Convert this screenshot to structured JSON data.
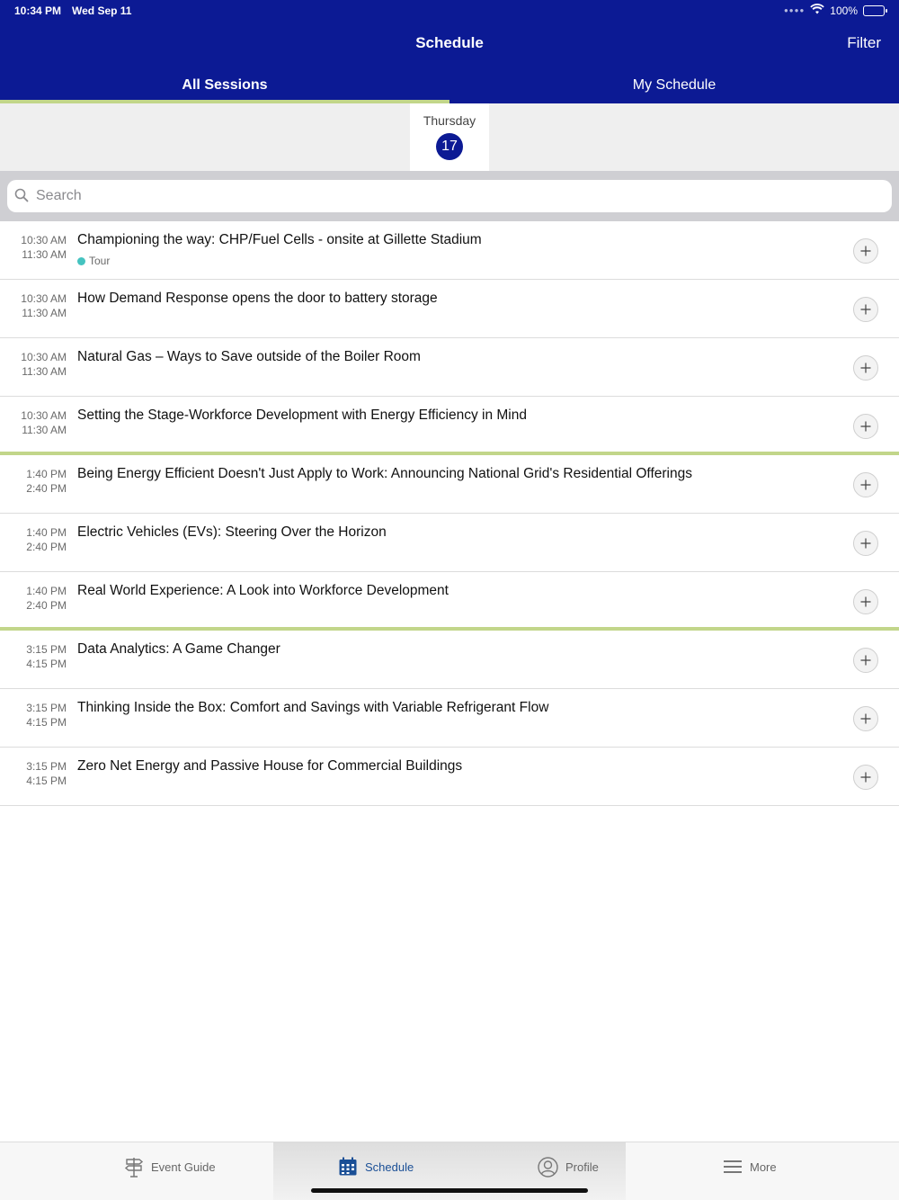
{
  "status_bar": {
    "time": "10:34 PM",
    "date": "Wed Sep 11",
    "battery": "100%"
  },
  "nav": {
    "title": "Schedule",
    "filter_label": "Filter"
  },
  "tabs": [
    {
      "label": "All Sessions",
      "active": true
    },
    {
      "label": "My Schedule",
      "active": false
    }
  ],
  "date_picker": {
    "weekday": "Thursday",
    "day": "17"
  },
  "search": {
    "placeholder": "Search"
  },
  "sessions": [
    {
      "start": "10:30 AM",
      "end": "11:30 AM",
      "title": "Championing the way:  CHP/Fuel Cells - onsite at  Gillette Stadium",
      "track": "Tour"
    },
    {
      "start": "10:30 AM",
      "end": "11:30 AM",
      "title": "How Demand Response opens the door to battery storage"
    },
    {
      "start": "10:30 AM",
      "end": "11:30 AM",
      "title": "Natural Gas – Ways to Save outside of the Boiler Room"
    },
    {
      "start": "10:30 AM",
      "end": "11:30 AM",
      "title": "Setting the Stage-Workforce Development with Energy Efficiency in Mind"
    },
    {
      "start": "1:40 PM",
      "end": "2:40 PM",
      "title": "Being Energy Efficient Doesn't Just Apply to Work:  Announcing National Grid's Residential Offerings"
    },
    {
      "start": "1:40 PM",
      "end": "2:40 PM",
      "title": "Electric Vehicles (EVs): Steering Over the Horizon"
    },
    {
      "start": "1:40 PM",
      "end": "2:40 PM",
      "title": "Real World Experience: A Look into Workforce Development"
    },
    {
      "start": "3:15 PM",
      "end": "4:15 PM",
      "title": "Data Analytics: A Game Changer"
    },
    {
      "start": "3:15 PM",
      "end": "4:15 PM",
      "title": "Thinking Inside the Box:  Comfort and Savings with Variable Refrigerant Flow"
    },
    {
      "start": "3:15 PM",
      "end": "4:15 PM",
      "title": "Zero Net Energy and Passive House for Commercial Buildings"
    }
  ],
  "tabbar": [
    {
      "label": "Event Guide",
      "icon": "signpost-icon",
      "active": false
    },
    {
      "label": "Schedule",
      "icon": "calendar-icon",
      "active": true
    },
    {
      "label": "Profile",
      "icon": "profile-icon",
      "active": false
    },
    {
      "label": "More",
      "icon": "menu-icon",
      "active": false
    }
  ],
  "colors": {
    "brand": "#0c1a94",
    "accent": "#c2d68a",
    "track_tour": "#45c3c0",
    "tab_active": "#1a4f96"
  }
}
